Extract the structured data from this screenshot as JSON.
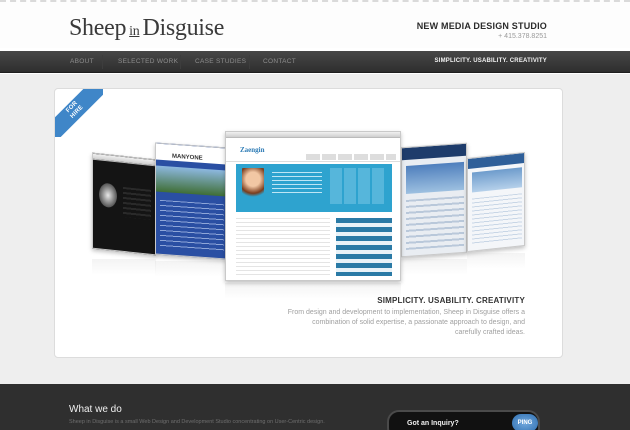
{
  "header": {
    "logo_left": "Sheep",
    "logo_mid": "in",
    "logo_right": "Disguise",
    "studio": "NEW MEDIA DESIGN STUDIO",
    "phone": "+ 415.378.8251"
  },
  "nav": {
    "items": [
      {
        "label": "ABOUT"
      },
      {
        "label": "SELECTED WORK"
      },
      {
        "label": "CASE STUDIES"
      },
      {
        "label": "CONTACT"
      }
    ],
    "tagline": "SIMPLICITY. USABILITY. CREATIVITY"
  },
  "hero": {
    "ribbon_line1": "FOR",
    "ribbon_line2": "HIRE",
    "shot_manyone_logo": "MANYONE",
    "shot_zaengin_logo": "Zaengin",
    "title": "SIMPLICITY. USABILITY. CREATIVITY",
    "description": "From design and development to implementation, Sheep in Disguise offers a combination of solid expertise, a passionate approach to design, and carefully crafted ideas."
  },
  "footer": {
    "what_we_do_title": "What we do",
    "what_we_do_text": "Sheep in Disguise is a small Web Design and Development Studio concentrating on User-Centric design.",
    "inquiry_label": "Got an Inquiry?",
    "ping_label": "PING"
  },
  "colors": {
    "nav_bg": "#3a3a3a",
    "ribbon": "#3f86c8",
    "footer_bg": "#2f2f2f",
    "accent_blue": "#2ea3cf"
  }
}
